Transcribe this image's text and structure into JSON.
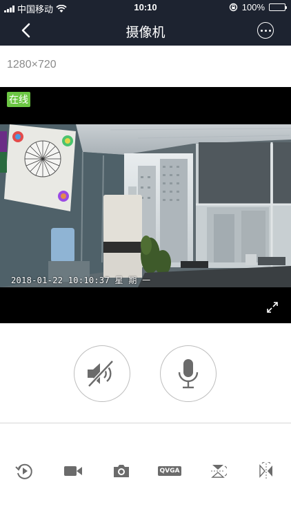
{
  "status_bar": {
    "carrier": "中国移动",
    "time": "10:10",
    "battery": "100%"
  },
  "nav": {
    "title": "摄像机"
  },
  "stream": {
    "resolution": "1280×720",
    "status_badge": "在线",
    "timestamp": "2018-01-22  10:10:37  星 期 一"
  },
  "toolbar": {
    "items": [
      "playback-icon",
      "record-icon",
      "snapshot-icon",
      "quality-qvga",
      "flip-vertical-icon",
      "mirror-icon"
    ],
    "quality_label": "QVGA"
  },
  "colors": {
    "header_bg": "#1d2330",
    "online": "#6cc644",
    "icon_gray": "#6b6b6b"
  }
}
